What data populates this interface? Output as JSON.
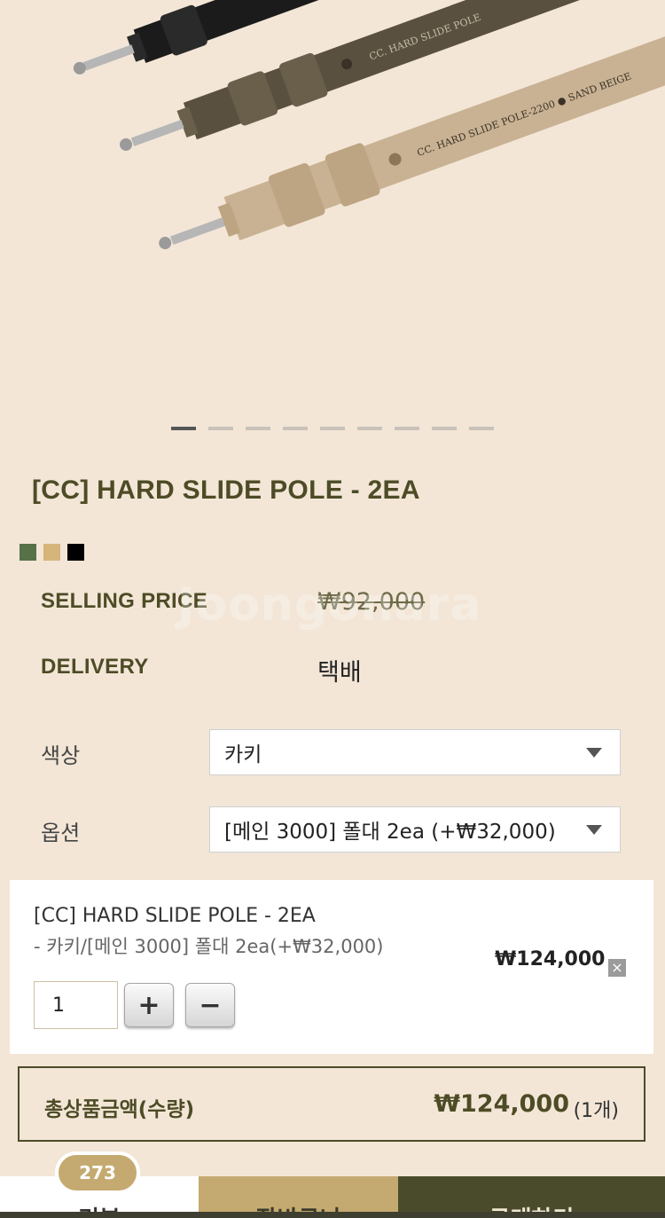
{
  "product": {
    "pole_text_1": "CC. HARD SLIDE POLE",
    "pole_text_2": "CC. HARD SLIDE POLE-2200 ● SAND BEIGE",
    "title": "[CC] HARD SLIDE POLE - 2EA",
    "colors": [
      "#577148",
      "#d5b57a",
      "#000000"
    ]
  },
  "gallery": {
    "total_slides": 9,
    "active_slide": 1
  },
  "watermark": "Joongonara",
  "info": {
    "selling_price_label": "SELLING PRICE",
    "selling_price_value": "₩92,000",
    "delivery_label": "DELIVERY",
    "delivery_value": "택배"
  },
  "options": {
    "color_label": "색상",
    "color_value": "카키",
    "option_label": "옵션",
    "option_value": "[메인 3000] 폴대 2ea (+₩32,000)"
  },
  "cart": {
    "item_name": "[CC] HARD SLIDE POLE - 2EA",
    "item_option": "- 카키/[메인 3000] 폴대 2ea(+₩32,000)",
    "price": "₩124,000",
    "remove": "×",
    "quantity": "1",
    "plus": "+",
    "minus": "−"
  },
  "total": {
    "label": "총상품금액(수량)",
    "amount": "₩124,000",
    "count": "(1개)"
  },
  "tabs": {
    "tab1": "리뷰",
    "tab2": "장바구니",
    "tab3": "구매하기",
    "review_count": "273"
  }
}
